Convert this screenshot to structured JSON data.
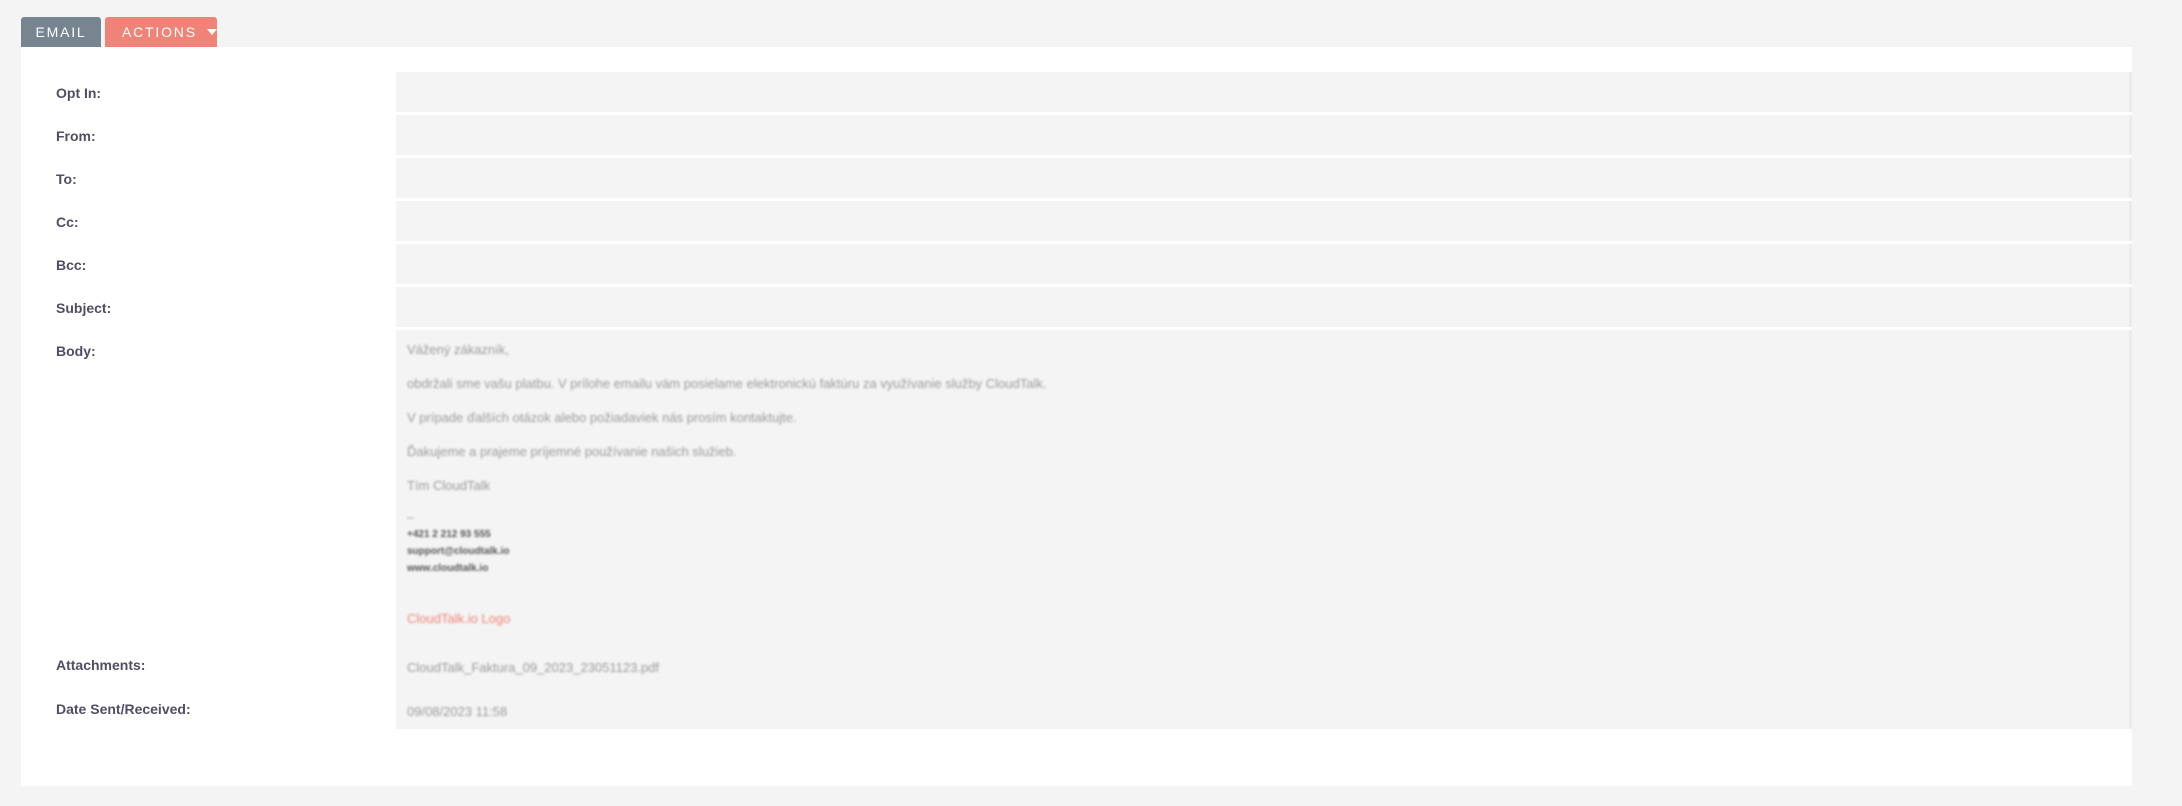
{
  "tabs": {
    "email_label": "EMAIL",
    "actions_label": "ACTIONS"
  },
  "fields": {
    "opt_in": {
      "label": "Opt In:",
      "value": ""
    },
    "from": {
      "label": "From:",
      "value": ""
    },
    "to": {
      "label": "To:",
      "value": ""
    },
    "cc": {
      "label": "Cc:",
      "value": ""
    },
    "bcc": {
      "label": "Bcc:",
      "value": ""
    },
    "subject": {
      "label": "Subject:",
      "value": ""
    },
    "body": {
      "label": "Body:",
      "paragraphs": [
        "Vážený zákazník,",
        "obdržali sme vašu platbu. V prílohe emailu vám posielame elektronickú faktúru za využívanie služby CloudTalk.",
        "V prípade ďalších otázok alebo požiadaviek nás prosím kontaktujte.",
        "Ďakujeme a prajeme príjemné používanie našich služieb.",
        "Tím CloudTalk"
      ],
      "separator": "--",
      "signature": {
        "phone": "+421 2 212 93 555",
        "email": "support@cloudtalk.io",
        "website": "www.cloudtalk.io"
      },
      "logo_link": "CloudTalk.io Logo"
    },
    "attachments": {
      "label": "Attachments:",
      "value": "CloudTalk_Faktura_09_2023_23051123.pdf"
    },
    "date_sent": {
      "label": "Date Sent/Received:",
      "value": "09/08/2023 11:58"
    }
  },
  "colors": {
    "email_tab": "#778591",
    "actions_tab": "#f08377",
    "label_text": "#534d64",
    "value_bg": "#f4f4f4",
    "link": "#f08377"
  }
}
